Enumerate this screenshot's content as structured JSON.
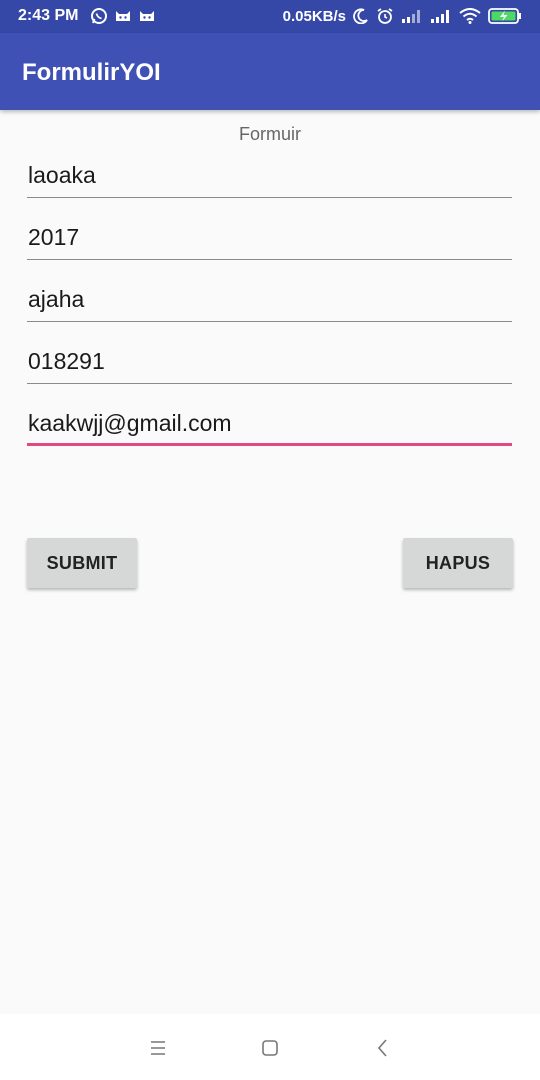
{
  "status_bar": {
    "time": "2:43 PM",
    "net_speed": "0.05KB/s",
    "left_icons": [
      "whatsapp-icon",
      "notification-cat-icon",
      "notification-cat-icon"
    ],
    "right_icons": [
      "moon-icon",
      "alarm-icon",
      "signal-icon",
      "signal-icon",
      "wifi-icon",
      "battery-charging-icon"
    ]
  },
  "app_bar": {
    "title": "FormulirYOI"
  },
  "form": {
    "caption": "Formuir",
    "fields": [
      {
        "value": "laoaka"
      },
      {
        "value": "2017"
      },
      {
        "value": "ajaha"
      },
      {
        "value": "018291"
      },
      {
        "value": "kaakwjj@gmail.com",
        "focused": true
      }
    ],
    "focus_color": "#e0487f"
  },
  "buttons": {
    "submit": "SUBMIT",
    "hapus": "HAPUS"
  },
  "nav_bar": {
    "items": [
      "menu-icon",
      "home-square-icon",
      "back-chevron-icon"
    ]
  },
  "colors": {
    "primary": "#3f51b5",
    "primary_dark": "#3548a8",
    "background": "#fafafa"
  }
}
